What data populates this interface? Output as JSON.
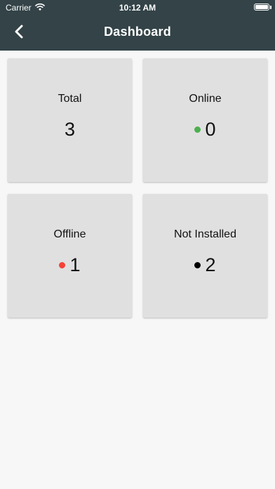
{
  "status_bar": {
    "carrier": "Carrier",
    "time": "10:12 AM",
    "icons": [
      "wifi-icon",
      "battery-icon"
    ]
  },
  "nav": {
    "title": "Dashboard",
    "back_icon": "chevron-left-icon"
  },
  "colors": {
    "header_bg": "#334348",
    "tile_bg": "#e0e0e0",
    "online": "#4caf50",
    "offline": "#f44336",
    "not_installed": "#000000"
  },
  "tiles": [
    {
      "label": "Total",
      "value": "3"
    },
    {
      "label": "Online",
      "value": "0",
      "indicator": "green-dot"
    },
    {
      "label": "Offline",
      "value": "1",
      "indicator": "red-dot"
    },
    {
      "label": "Not Installed",
      "value": "2",
      "indicator": "black-dot"
    }
  ]
}
